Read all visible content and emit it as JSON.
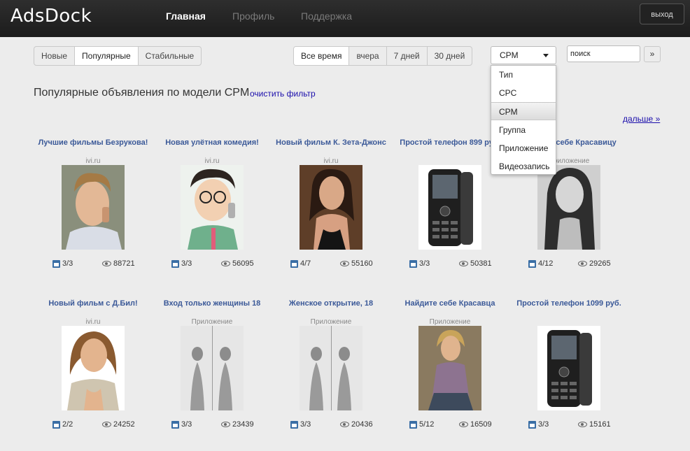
{
  "header": {
    "brand": "AdsDock",
    "nav": [
      "Главная",
      "Профиль",
      "Поддержка"
    ],
    "logout": "выход"
  },
  "filters": {
    "sort": [
      "Новые",
      "Популярные",
      "Стабильные"
    ],
    "sort_active": "Популярные",
    "period": [
      "Все время",
      "вчера",
      "7 дней",
      "30 дней"
    ],
    "period_active": "Все время",
    "model_selected": "CPM",
    "model_options": [
      "Тип",
      "CPC",
      "CPM",
      "Группа",
      "Приложение",
      "Видеозапись"
    ],
    "search_value": "поиск",
    "search_button": "»"
  },
  "page": {
    "heading": "Популярные объявления по модели CPM",
    "clear_filter": "очистить фильтр",
    "next": "дальше »"
  },
  "ads": [
    {
      "title": "Лучшие фильмы Безрукова!",
      "source": "ivi.ru",
      "image": "portrait-man-phone",
      "count": "3/3",
      "views": "88721"
    },
    {
      "title": "Новая улётная комедия!",
      "source": "ivi.ru",
      "image": "cartoon-nerd-phone",
      "count": "3/3",
      "views": "56095"
    },
    {
      "title": "Новый фильм К. Зета-Джонс",
      "source": "ivi.ru",
      "image": "portrait-woman-black-dress",
      "count": "4/7",
      "views": "55160"
    },
    {
      "title": "Простой телефон 899 руб.",
      "source": "",
      "image": "black-mobile-phone",
      "count": "3/3",
      "views": "50381"
    },
    {
      "title": "Найдите себе Красавицу",
      "source": "Приложение",
      "image": "bw-portrait-woman",
      "count": "4/12",
      "views": "29265"
    },
    {
      "title": "Новый фильм с Д.Бил!",
      "source": "ivi.ru",
      "image": "portrait-woman-scarf",
      "count": "2/2",
      "views": "24252"
    },
    {
      "title": "Вход только женщины 18",
      "source": "Приложение",
      "image": "silhouette-glass-door",
      "count": "3/3",
      "views": "23439"
    },
    {
      "title": "Женское открытие, 18",
      "source": "Приложение",
      "image": "silhouette-glass-door",
      "count": "3/3",
      "views": "20436"
    },
    {
      "title": "Найдите себе Красавца",
      "source": "Приложение",
      "image": "young-man-sitting",
      "count": "5/12",
      "views": "16509"
    },
    {
      "title": "Простой телефон 1099 руб.",
      "source": "",
      "image": "black-mobile-phone",
      "count": "3/3",
      "views": "15161"
    }
  ]
}
